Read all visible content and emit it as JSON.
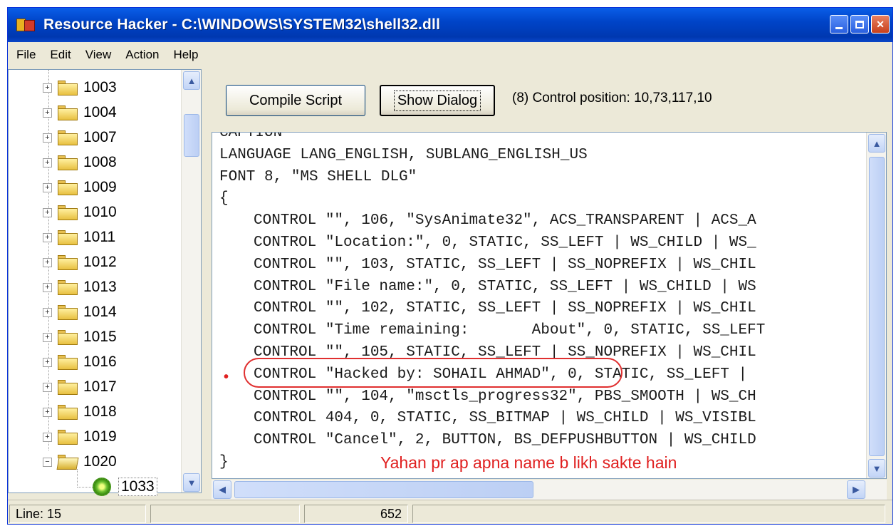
{
  "window": {
    "title": "Resource Hacker  -  C:\\WINDOWS\\SYSTEM32\\shell32.dll"
  },
  "menu": [
    "File",
    "Edit",
    "View",
    "Action",
    "Help"
  ],
  "tree": {
    "folders": [
      "1003",
      "1004",
      "1007",
      "1008",
      "1009",
      "1010",
      "1011",
      "1012",
      "1013",
      "1014",
      "1015",
      "1016",
      "1017",
      "1018",
      "1019"
    ],
    "open_folder": "1020",
    "selected_leaf": "1033"
  },
  "toolbar": {
    "compile_label": "Compile Script",
    "show_dialog_label": "Show Dialog",
    "status_message": "(8)  Control position: 10,73,117,10"
  },
  "editor": {
    "lines": [
      "CAPTION \"\"",
      "LANGUAGE LANG_ENGLISH, SUBLANG_ENGLISH_US",
      "FONT 8, \"MS SHELL DLG\"",
      "{",
      "CONTROL \"\", 106, \"SysAnimate32\", ACS_TRANSPARENT | ACS_A",
      "CONTROL \"Location:\", 0, STATIC, SS_LEFT | WS_CHILD | WS_",
      "CONTROL \"\", 103, STATIC, SS_LEFT | SS_NOPREFIX | WS_CHIL",
      "CONTROL \"File name:\", 0, STATIC, SS_LEFT | WS_CHILD | WS",
      "CONTROL \"\", 102, STATIC, SS_LEFT | SS_NOPREFIX | WS_CHIL",
      "CONTROL \"Time remaining:       About\", 0, STATIC, SS_LEFT",
      "CONTROL \"\", 105, STATIC, SS_LEFT | SS_NOPREFIX | WS_CHIL",
      "CONTROL \"Hacked by: SOHAIL AHMAD\", 0, STATIC, SS_LEFT |",
      "CONTROL \"\", 104, \"msctls_progress32\", PBS_SMOOTH | WS_CH",
      "CONTROL 404, 0, STATIC, SS_BITMAP | WS_CHILD | WS_VISIBL",
      "CONTROL \"Cancel\", 2, BUTTON, BS_DEFPUSHBUTTON | WS_CHILD",
      "}"
    ],
    "breakpoint_marker": "•",
    "annotation": "Yahan pr ap apna name b likh sakte hain",
    "annotation_color": "#e02020"
  },
  "statusbar": {
    "line": "Line: 15",
    "position": "652"
  },
  "icons": [
    "app-icon",
    "folder-icon",
    "dialog-resource-icon",
    "minimize-icon",
    "maximize-icon",
    "close-icon"
  ]
}
